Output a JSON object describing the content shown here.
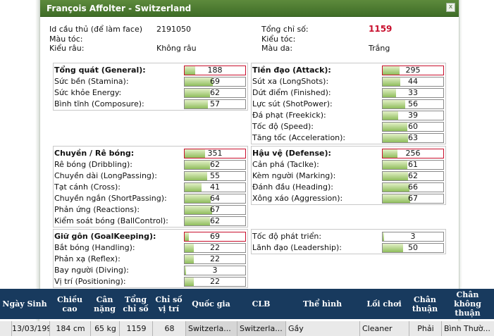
{
  "dialog": {
    "title": "François Affolter - Switzerland",
    "close_label": "x",
    "colors": {
      "title_bar": "#4a7a30",
      "total_value": "#c8102e",
      "bar_fill": "#8fbe5d",
      "table_header": "#183a5e"
    }
  },
  "info": {
    "id_label": "Id cầu thủ (để làm face)",
    "id_value": "2191050",
    "hair_color_label": "Màu tóc:",
    "hair_color_value": "",
    "beard_label": "Kiểu râu:",
    "beard_value": "Không râu",
    "total_label": "Tổng chỉ số:",
    "total_value": "1159",
    "hairstyle_label": "Kiểu tóc:",
    "hairstyle_value": "",
    "skin_label": "Màu da:",
    "skin_value": "Trắng"
  },
  "groups": {
    "general": {
      "rows": [
        {
          "label": "Tổng quát (General):",
          "value": 188
        },
        {
          "label": "Sức bền (Stamina):",
          "value": 69
        },
        {
          "label": "Sức khỏe Energy:",
          "value": 62
        },
        {
          "label": "Bình tĩnh (Composure):",
          "value": 57
        }
      ]
    },
    "attack": {
      "rows": [
        {
          "label": "Tiền đạo (Attack):",
          "value": 295
        },
        {
          "label": "Sút xa (LongShots):",
          "value": 44
        },
        {
          "label": "Dứt điểm (Finished):",
          "value": 33
        },
        {
          "label": "Lực sút (ShotPower):",
          "value": 56
        },
        {
          "label": "Đá phạt (Freekick):",
          "value": 39
        },
        {
          "label": "Tốc độ (Speed):",
          "value": 60
        },
        {
          "label": "Tăng tốc (Acceleration):",
          "value": 63
        }
      ]
    },
    "dribble": {
      "rows": [
        {
          "label": "Chuyền / Rê bóng:",
          "value": 351
        },
        {
          "label": "Rê bóng (Dribbling):",
          "value": 62
        },
        {
          "label": "Chuyền dài (LongPassing):",
          "value": 55
        },
        {
          "label": "Tạt cánh (Cross):",
          "value": 41
        },
        {
          "label": "Chuyền ngắn (ShortPassing):",
          "value": 64
        },
        {
          "label": "Phản ứng (Reactions):",
          "value": 67
        },
        {
          "label": "Kiểm soát bóng (BallControl):",
          "value": 62
        }
      ]
    },
    "defense": {
      "rows": [
        {
          "label": "Hậu vệ (Defense):",
          "value": 256
        },
        {
          "label": "Cản phá (Taclke):",
          "value": 61
        },
        {
          "label": "Kèm người (Marking):",
          "value": 62
        },
        {
          "label": "Đánh đầu (Heading):",
          "value": 66
        },
        {
          "label": "Xông xáo (Aggression):",
          "value": 67
        }
      ]
    },
    "goalkeeping": {
      "rows": [
        {
          "label": "Giữ gôn (GoalKeeping):",
          "value": 69
        },
        {
          "label": "Bắt bóng (Handling):",
          "value": 22
        },
        {
          "label": "Phản xạ (Reflex):",
          "value": 22
        },
        {
          "label": "Bay người (Diving):",
          "value": 3
        },
        {
          "label": "Vị trí (Positioning):",
          "value": 22
        }
      ]
    },
    "growth": {
      "rows": [
        {
          "label": "Tốc độ phát triển:",
          "value": 3
        },
        {
          "label": "Lãnh đạo (Leadership):",
          "value": 50
        }
      ]
    }
  },
  "table": {
    "headers": [
      "Ngày Sinh",
      "Chiều\ncao",
      "Cân\nnặng",
      "Tổng\nchỉ số",
      "Chỉ số\nvị trí",
      "Quốc gia",
      "CLB",
      "Thể hình",
      "Lối chơi",
      "Chân\nthuận",
      "Chân\nkhông\nthuận"
    ],
    "row": [
      "13/03/1991",
      "184 cm",
      "65 kg",
      "1159",
      "68",
      "Switzerla...",
      "Switzerla...",
      "Gầy",
      "Cleaner",
      "Phải",
      "Bình Thườ..."
    ]
  }
}
